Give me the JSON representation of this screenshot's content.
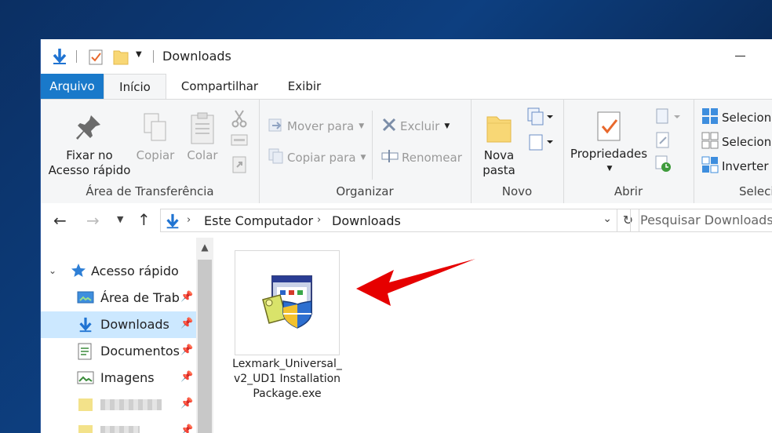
{
  "window": {
    "title": "Downloads"
  },
  "ribbon_tabs": [
    {
      "label": "Arquivo"
    },
    {
      "label": "Início"
    },
    {
      "label": "Compartilhar"
    },
    {
      "label": "Exibir"
    }
  ],
  "clipboard": {
    "pin_label_line1": "Fixar no",
    "pin_label_line2": "Acesso rápido",
    "copy_label": "Copiar",
    "paste_label": "Colar",
    "group_label": "Área de Transferência"
  },
  "organize": {
    "move_to": "Mover para",
    "copy_to": "Copiar para",
    "delete": "Excluir",
    "rename": "Renomear",
    "group_label": "Organizar"
  },
  "new": {
    "new_folder_line1": "Nova",
    "new_folder_line2": "pasta",
    "group_label": "Novo"
  },
  "open": {
    "properties": "Propriedades",
    "group_label": "Abrir"
  },
  "select": {
    "select_all": "Seleciona",
    "select_none": "Seleciona",
    "invert": "Inverter s",
    "group_label": "Seleci"
  },
  "address": {
    "segments": [
      "Este Computador",
      "Downloads"
    ],
    "search_placeholder": "Pesquisar Downloads"
  },
  "nav_pane": {
    "quick_access": "Acesso rápido",
    "items": [
      {
        "label": "Área de Traba",
        "icon": "desktop-icon"
      },
      {
        "label": "Downloads",
        "icon": "download-arrow-icon"
      },
      {
        "label": "Documentos",
        "icon": "document-icon"
      },
      {
        "label": "Imagens",
        "icon": "pictures-icon"
      }
    ]
  },
  "files": [
    {
      "name": "Lexmark_Universal_v2_UD1 InstallationPackage.exe",
      "icon": "installer-icon"
    }
  ],
  "colors": {
    "accent": "#1979ca",
    "selection": "#cce8ff",
    "arrow": "#e60000"
  }
}
